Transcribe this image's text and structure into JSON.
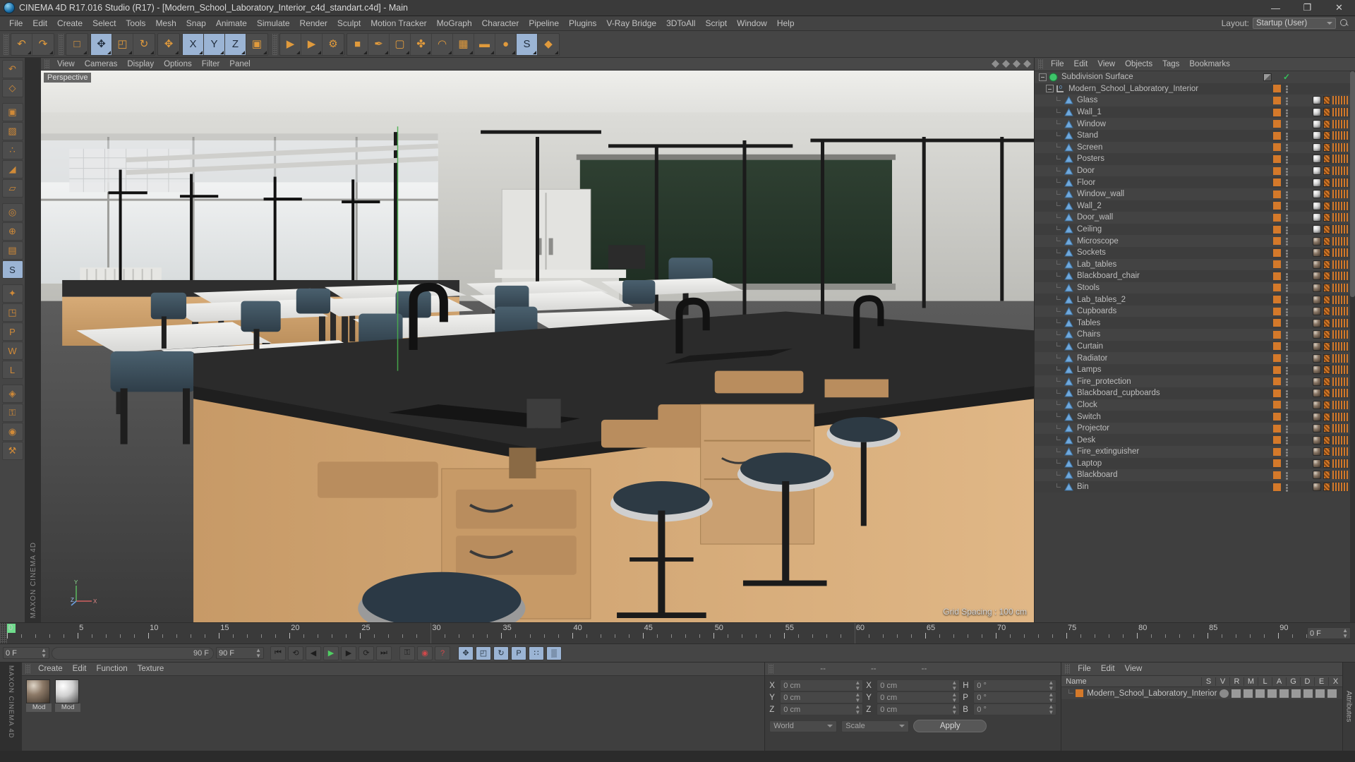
{
  "window": {
    "title": "CINEMA 4D R17.016 Studio (R17) - [Modern_School_Laboratory_Interior_c4d_standart.c4d] - Main",
    "minimize": "—",
    "maximize": "❐",
    "close": "✕"
  },
  "menubar": {
    "items": [
      "File",
      "Edit",
      "Create",
      "Select",
      "Tools",
      "Mesh",
      "Snap",
      "Animate",
      "Simulate",
      "Render",
      "Sculpt",
      "Motion Tracker",
      "MoGraph",
      "Character",
      "Pipeline",
      "Plugins",
      "V-Ray Bridge",
      "3DToAll",
      "Script",
      "Window",
      "Help"
    ],
    "layout_label": "Layout:",
    "layout_value": "Startup (User)"
  },
  "toolbar": {
    "groups": [
      {
        "name": "history",
        "buttons": [
          {
            "name": "undo-button",
            "glyph": "↶",
            "active": false
          },
          {
            "name": "redo-button",
            "glyph": "↷",
            "active": false
          }
        ]
      },
      {
        "name": "selection",
        "buttons": [
          {
            "name": "live-selection-button",
            "glyph": "□",
            "active": false
          }
        ]
      },
      {
        "name": "transform",
        "buttons": [
          {
            "name": "move-tool-button",
            "glyph": "✥",
            "active": true
          },
          {
            "name": "scale-tool-button",
            "glyph": "◰",
            "active": false
          },
          {
            "name": "rotate-tool-button",
            "glyph": "↻",
            "active": false
          }
        ]
      },
      {
        "name": "move-extra",
        "buttons": [
          {
            "name": "move-axis-button",
            "glyph": "✥",
            "active": false
          }
        ]
      },
      {
        "name": "axis-locks",
        "buttons": [
          {
            "name": "lock-x-axis-button",
            "glyph": "X",
            "active": true
          },
          {
            "name": "lock-y-axis-button",
            "glyph": "Y",
            "active": true
          },
          {
            "name": "lock-z-axis-button",
            "glyph": "Z",
            "active": true
          },
          {
            "name": "world-object-coordinates-button",
            "glyph": "▣",
            "active": false
          }
        ]
      },
      {
        "name": "render",
        "buttons": [
          {
            "name": "render-view-button",
            "glyph": "▶",
            "active": false
          },
          {
            "name": "render-region-button",
            "glyph": "▶",
            "active": false
          },
          {
            "name": "render-settings-button",
            "glyph": "⚙",
            "active": false
          }
        ]
      },
      {
        "name": "create",
        "buttons": [
          {
            "name": "add-cube-button",
            "glyph": "■",
            "active": false
          },
          {
            "name": "add-spline-button",
            "glyph": "✒",
            "active": false
          },
          {
            "name": "generator-button",
            "glyph": "▢",
            "active": false
          },
          {
            "name": "array-button",
            "glyph": "✤",
            "active": false
          },
          {
            "name": "bend-deformer-button",
            "glyph": "◠",
            "active": false
          },
          {
            "name": "scene-floor-button",
            "glyph": "▦",
            "active": false
          },
          {
            "name": "add-camera-button",
            "glyph": "▬",
            "active": false
          },
          {
            "name": "add-light-button",
            "glyph": "●",
            "active": false
          },
          {
            "name": "sketch-toon-button",
            "glyph": "S",
            "active": true
          },
          {
            "name": "python-script-button",
            "glyph": "◆",
            "active": false
          }
        ]
      }
    ]
  },
  "left_tools": {
    "buttons": [
      {
        "name": "undo-view-button",
        "glyph": "↶",
        "active": false
      },
      {
        "name": "make-editable-button",
        "glyph": "◇",
        "active": false
      },
      {
        "name": "model-mode-button",
        "glyph": "▣",
        "active": false
      },
      {
        "name": "texture-mode-button",
        "glyph": "▨",
        "active": false
      },
      {
        "name": "points-mode-button",
        "glyph": "∴",
        "active": false
      },
      {
        "name": "edges-mode-button",
        "glyph": "◢",
        "active": false
      },
      {
        "name": "polygons-mode-button",
        "glyph": "▱",
        "active": false
      },
      {
        "name": "viewport-solo-button",
        "glyph": "◎",
        "active": false
      },
      {
        "name": "enable-axis-button",
        "glyph": "⊕",
        "active": false
      },
      {
        "name": "workplane-button",
        "glyph": "▤",
        "active": false
      },
      {
        "name": "sculpt-mode-button",
        "glyph": "S",
        "active": true
      },
      {
        "name": "snap-button",
        "glyph": "✦",
        "active": false
      },
      {
        "name": "quantize-button",
        "glyph": "◳",
        "active": false
      },
      {
        "name": "p-button",
        "glyph": "P",
        "active": false
      },
      {
        "name": "w-button",
        "glyph": "W",
        "active": false
      },
      {
        "name": "l-button",
        "glyph": "L",
        "active": false
      },
      {
        "name": "edge-snap-button",
        "glyph": "◈",
        "active": false
      },
      {
        "name": "lock-button",
        "glyph": "⚿",
        "active": false
      },
      {
        "name": "target-button",
        "glyph": "◉",
        "active": false
      },
      {
        "name": "plugin-button",
        "glyph": "⚒",
        "active": false
      }
    ],
    "brand": "MAXON CINEMA 4D"
  },
  "viewport": {
    "menu": [
      "View",
      "Cameras",
      "Display",
      "Options",
      "Filter",
      "Panel"
    ],
    "label": "Perspective",
    "grid_spacing": "Grid Spacing : 100 cm",
    "axis_x": "X",
    "axis_y": "Y",
    "axis_z": "Z"
  },
  "object_manager": {
    "menu": [
      "File",
      "Edit",
      "View",
      "Objects",
      "Tags",
      "Bookmarks"
    ],
    "root": {
      "name": "Subdivision Surface",
      "icon": "subdivision-surface-icon"
    },
    "group": {
      "name": "Modern_School_Laboratory_Interior",
      "icon": "null-object-icon"
    },
    "objects": [
      {
        "name": "Glass",
        "mat": "shaded"
      },
      {
        "name": "Wall_1",
        "mat": "shaded"
      },
      {
        "name": "Window",
        "mat": "shaded"
      },
      {
        "name": "Stand",
        "mat": "shaded"
      },
      {
        "name": "Screen",
        "mat": "shaded"
      },
      {
        "name": "Posters",
        "mat": "shaded"
      },
      {
        "name": "Door",
        "mat": "shaded"
      },
      {
        "name": "Floor",
        "mat": "shaded"
      },
      {
        "name": "Window_wall",
        "mat": "shaded"
      },
      {
        "name": "Wall_2",
        "mat": "shaded"
      },
      {
        "name": "Door_wall",
        "mat": "shaded"
      },
      {
        "name": "Ceiling",
        "mat": "shaded"
      },
      {
        "name": "Microscope",
        "mat": "textured"
      },
      {
        "name": "Sockets",
        "mat": "textured"
      },
      {
        "name": "Lab_tables",
        "mat": "textured"
      },
      {
        "name": "Blackboard_chair",
        "mat": "textured"
      },
      {
        "name": "Stools",
        "mat": "textured"
      },
      {
        "name": "Lab_tables_2",
        "mat": "textured"
      },
      {
        "name": "Cupboards",
        "mat": "textured"
      },
      {
        "name": "Tables",
        "mat": "textured"
      },
      {
        "name": "Chairs",
        "mat": "textured"
      },
      {
        "name": "Curtain",
        "mat": "textured"
      },
      {
        "name": "Radiator",
        "mat": "textured"
      },
      {
        "name": "Lamps",
        "mat": "textured"
      },
      {
        "name": "Fire_protection",
        "mat": "textured"
      },
      {
        "name": "Blackboard_cupboards",
        "mat": "textured"
      },
      {
        "name": "Clock",
        "mat": "textured"
      },
      {
        "name": "Switch",
        "mat": "textured"
      },
      {
        "name": "Projector",
        "mat": "textured"
      },
      {
        "name": "Desk",
        "mat": "textured"
      },
      {
        "name": "Fire_extinguisher",
        "mat": "textured"
      },
      {
        "name": "Laptop",
        "mat": "textured"
      },
      {
        "name": "Blackboard",
        "mat": "textured"
      },
      {
        "name": "Bin",
        "mat": "textured"
      }
    ]
  },
  "structure_manager": {
    "menu": [
      "File",
      "Edit",
      "View"
    ],
    "columns": [
      "Name",
      "S",
      "V",
      "R",
      "M",
      "L",
      "A",
      "G",
      "D",
      "E",
      "X"
    ],
    "row_name": "Modern_School_Laboratory_Interior",
    "tab_label": "Attributes"
  },
  "timeline": {
    "ticks": [
      0,
      5,
      10,
      15,
      20,
      25,
      30,
      35,
      40,
      45,
      50,
      55,
      60,
      65,
      70,
      75,
      80,
      85,
      90
    ],
    "start_frame": "0 F",
    "current_frame": "0 F",
    "end_frame": "90 F",
    "preview_end": "90 F",
    "range_end": "90 F"
  },
  "transport": {
    "buttons": [
      {
        "name": "go-to-start-button",
        "glyph": "⏮",
        "active": false
      },
      {
        "name": "previous-keyframe-button",
        "glyph": "⟲",
        "active": false
      },
      {
        "name": "step-back-button",
        "glyph": "◀",
        "active": false
      },
      {
        "name": "play-button",
        "glyph": "▶",
        "active": false
      },
      {
        "name": "step-forward-button",
        "glyph": "▶",
        "active": false
      },
      {
        "name": "next-keyframe-button",
        "glyph": "⟳",
        "active": false
      },
      {
        "name": "go-to-end-button",
        "glyph": "⏭",
        "active": false
      },
      {
        "name": "record-active-objects-button",
        "glyph": "⚿",
        "active": false
      },
      {
        "name": "autokeying-button",
        "glyph": "◉",
        "active": false
      },
      {
        "name": "keyframe-selection-button",
        "glyph": "?",
        "active": false
      },
      {
        "name": "position-key-button",
        "glyph": "✥",
        "active": true
      },
      {
        "name": "scale-key-button",
        "glyph": "◰",
        "active": true
      },
      {
        "name": "rotation-key-button",
        "glyph": "↻",
        "active": true
      },
      {
        "name": "parameter-key-button",
        "glyph": "P",
        "active": true
      },
      {
        "name": "point-level-animation-button",
        "glyph": "∷",
        "active": true
      },
      {
        "name": "timeline-button",
        "glyph": "▒",
        "active": true
      }
    ]
  },
  "material_manager": {
    "menu": [
      "Create",
      "Edit",
      "Function",
      "Texture"
    ],
    "materials": [
      {
        "name": "Mod",
        "preview": "textured"
      },
      {
        "name": "Mod",
        "preview": "shaded"
      }
    ]
  },
  "coordinates": {
    "headers": [
      "--",
      "--",
      "--"
    ],
    "position_label": "X",
    "rows": [
      {
        "axis1": "X",
        "val1": "0 cm",
        "axis2": "X",
        "val2": "0 cm",
        "axis3": "H",
        "val3": "0 °"
      },
      {
        "axis1": "Y",
        "val1": "0 cm",
        "axis2": "Y",
        "val2": "0 cm",
        "axis3": "P",
        "val3": "0 °"
      },
      {
        "axis1": "Z",
        "val1": "0 cm",
        "axis2": "Z",
        "val2": "0 cm",
        "axis3": "B",
        "val3": "0 °"
      }
    ],
    "system_select": "World",
    "mode_select": "Scale",
    "apply_label": "Apply"
  },
  "colors": {
    "accent_orange": "#d4792a",
    "active_blue": "#9bb4d4",
    "panel_bg": "#3f3f3f",
    "toolbar_bg": "#454545"
  }
}
